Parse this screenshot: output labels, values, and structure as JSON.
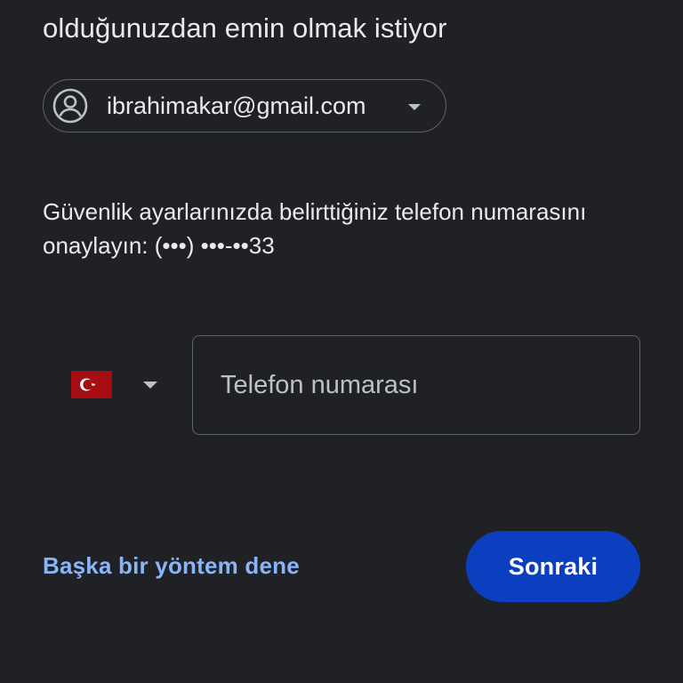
{
  "heading": {
    "visible_line": "olduğunuzdan emin olmak istiyor"
  },
  "account": {
    "email": "ibrahimakar@gmail.com",
    "avatar_icon": "account-circle-icon",
    "caret_icon": "arrow-drop-down-icon"
  },
  "verification": {
    "line1": "Güvenlik ayarlarınızda belirttiğiniz telefon numarasını",
    "line2": "onaylayın: (•••) •••-••33"
  },
  "phone": {
    "country_flag_icon": "turkey-flag-icon",
    "country_caret_icon": "arrow-drop-down-icon",
    "placeholder": "Telefon numarası",
    "value": ""
  },
  "actions": {
    "alt_method_label": "Başka bir yöntem dene",
    "next_label": "Sonraki"
  },
  "colors": {
    "background": "#202124",
    "text": "#e8eaed",
    "link": "#8ab4f8",
    "primary_button": "#0b3fbf",
    "outline": "#5f6368",
    "flag_red": "#a50d12"
  }
}
